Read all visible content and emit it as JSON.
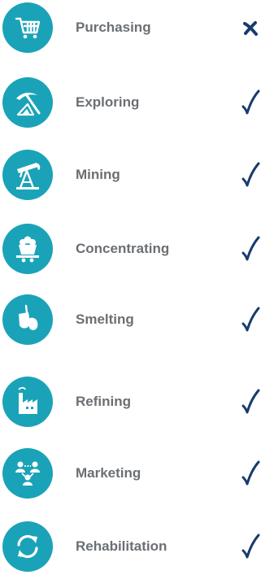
{
  "colors": {
    "icon_background": "#1aa3b8",
    "label_text": "#6b6f73",
    "mark": "#173c6d"
  },
  "stages": [
    {
      "label": "Purchasing",
      "icon": "shopping-cart-icon",
      "status": "cross"
    },
    {
      "label": "Exploring",
      "icon": "pickaxe-icon",
      "status": "check"
    },
    {
      "label": "Mining",
      "icon": "oil-pump-icon",
      "status": "check"
    },
    {
      "label": "Concentrating",
      "icon": "ore-cart-icon",
      "status": "check"
    },
    {
      "label": "Smelting",
      "icon": "ladle-pour-icon",
      "status": "check"
    },
    {
      "label": "Refining",
      "icon": "factory-icon",
      "status": "check"
    },
    {
      "label": "Marketing",
      "icon": "people-network-icon",
      "status": "check"
    },
    {
      "label": "Rehabilitation",
      "icon": "recycle-arrows-icon",
      "status": "check"
    }
  ]
}
